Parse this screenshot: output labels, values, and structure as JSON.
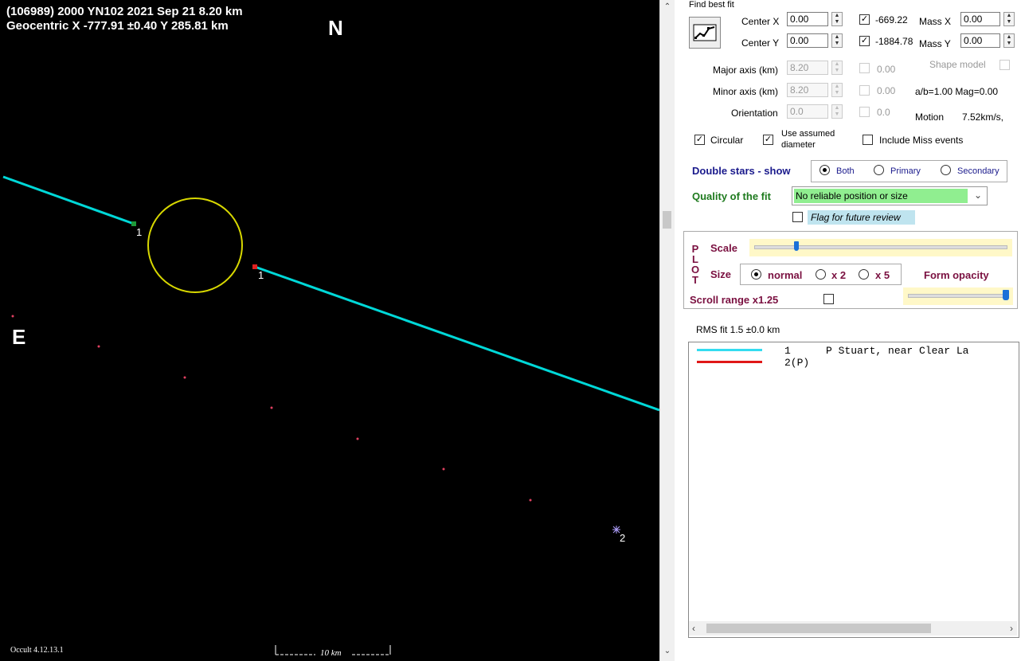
{
  "plot": {
    "title_line1": "(106989) 2000 YN102  2021 Sep 21   8.20 km",
    "title_line2": "Geocentric  X  -777.91 ±0.40  Y 285.81 km",
    "north": "N",
    "east": "E",
    "chord1_label_a": "1",
    "chord1_label_b": "1",
    "chord2_label": "2",
    "version": "Occult 4.12.13.1",
    "scale_bar": "10 km",
    "colors": {
      "chord": "#00d8d8",
      "ellipse": "#d8d800",
      "disappear": "#1e9a3a",
      "reappear": "#e02020",
      "path_dots": "#e04060"
    }
  },
  "panel": {
    "find_best_fit": "Find best fit",
    "center_x_label": "Center X",
    "center_x_value": "0.00",
    "center_y_label": "Center Y",
    "center_y_value": "0.00",
    "offset_x": "-669.22",
    "offset_y": "-1884.78",
    "mass_x_label": "Mass X",
    "mass_x_value": "0.00",
    "mass_y_label": "Mass Y",
    "mass_y_value": "0.00",
    "major_label": "Major axis (km)",
    "major_value": "8.20",
    "major_fit": "0.00",
    "minor_label": "Minor axis (km)",
    "minor_value": "8.20",
    "minor_fit": "0.00",
    "orient_label": "Orientation",
    "orient_value": "0.0",
    "orient_fit": "0.0",
    "shape_model": "Shape model",
    "ab_mag": "a/b=1.00  Mag=0.00",
    "motion_label": "Motion",
    "motion_value": "7.52km/s,",
    "circular": "Circular",
    "assumed_1": "Use assumed",
    "assumed_2": "diameter",
    "include_miss": "Include Miss events",
    "double_stars": "Double stars - show",
    "both": "Both",
    "primary": "Primary",
    "secondary": "Secondary",
    "quality_label": "Quality of the fit",
    "quality_value": "No reliable position or size",
    "flag_review": "Flag for future review",
    "plot_letters": [
      "P",
      "L",
      "O",
      "T"
    ],
    "scale_label": "Scale",
    "size_label": "Size",
    "normal": "normal",
    "x2": "x 2",
    "x5": "x 5",
    "form_opacity": "Form opacity",
    "scroll_range": "Scroll range x1.25",
    "rms_fit": "RMS fit 1.5 ±0.0 km",
    "legend": [
      {
        "num": "1",
        "text": "P Stuart, near Clear La",
        "color": "#33dcf0"
      },
      {
        "num": "2(P)",
        "text": "",
        "color": "#e01818"
      }
    ]
  }
}
